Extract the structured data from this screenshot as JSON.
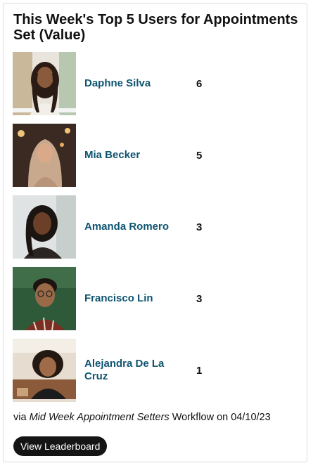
{
  "widget": {
    "title": "This Week's Top 5 Users for Appointments Set (Value)",
    "users": [
      {
        "name": "Daphne Silva",
        "value": "6",
        "avatar": "portrait-photo"
      },
      {
        "name": "Mia Becker",
        "value": "5",
        "avatar": "portrait-photo"
      },
      {
        "name": "Amanda Romero",
        "value": "3",
        "avatar": "portrait-photo"
      },
      {
        "name": "Francisco Lin",
        "value": "3",
        "avatar": "portrait-photo"
      },
      {
        "name": "Alejandra De La Cruz",
        "value": "1",
        "avatar": "portrait-photo"
      }
    ],
    "footer": {
      "prefix": "via",
      "workflow": "Mid Week Appointment Setters",
      "middle": "Workflow on",
      "date": "04/10/23"
    },
    "button_label": "View Leaderboard"
  },
  "colors": {
    "name_link": "#0e5470",
    "button_bg": "#151515",
    "button_text": "#ffffff"
  }
}
